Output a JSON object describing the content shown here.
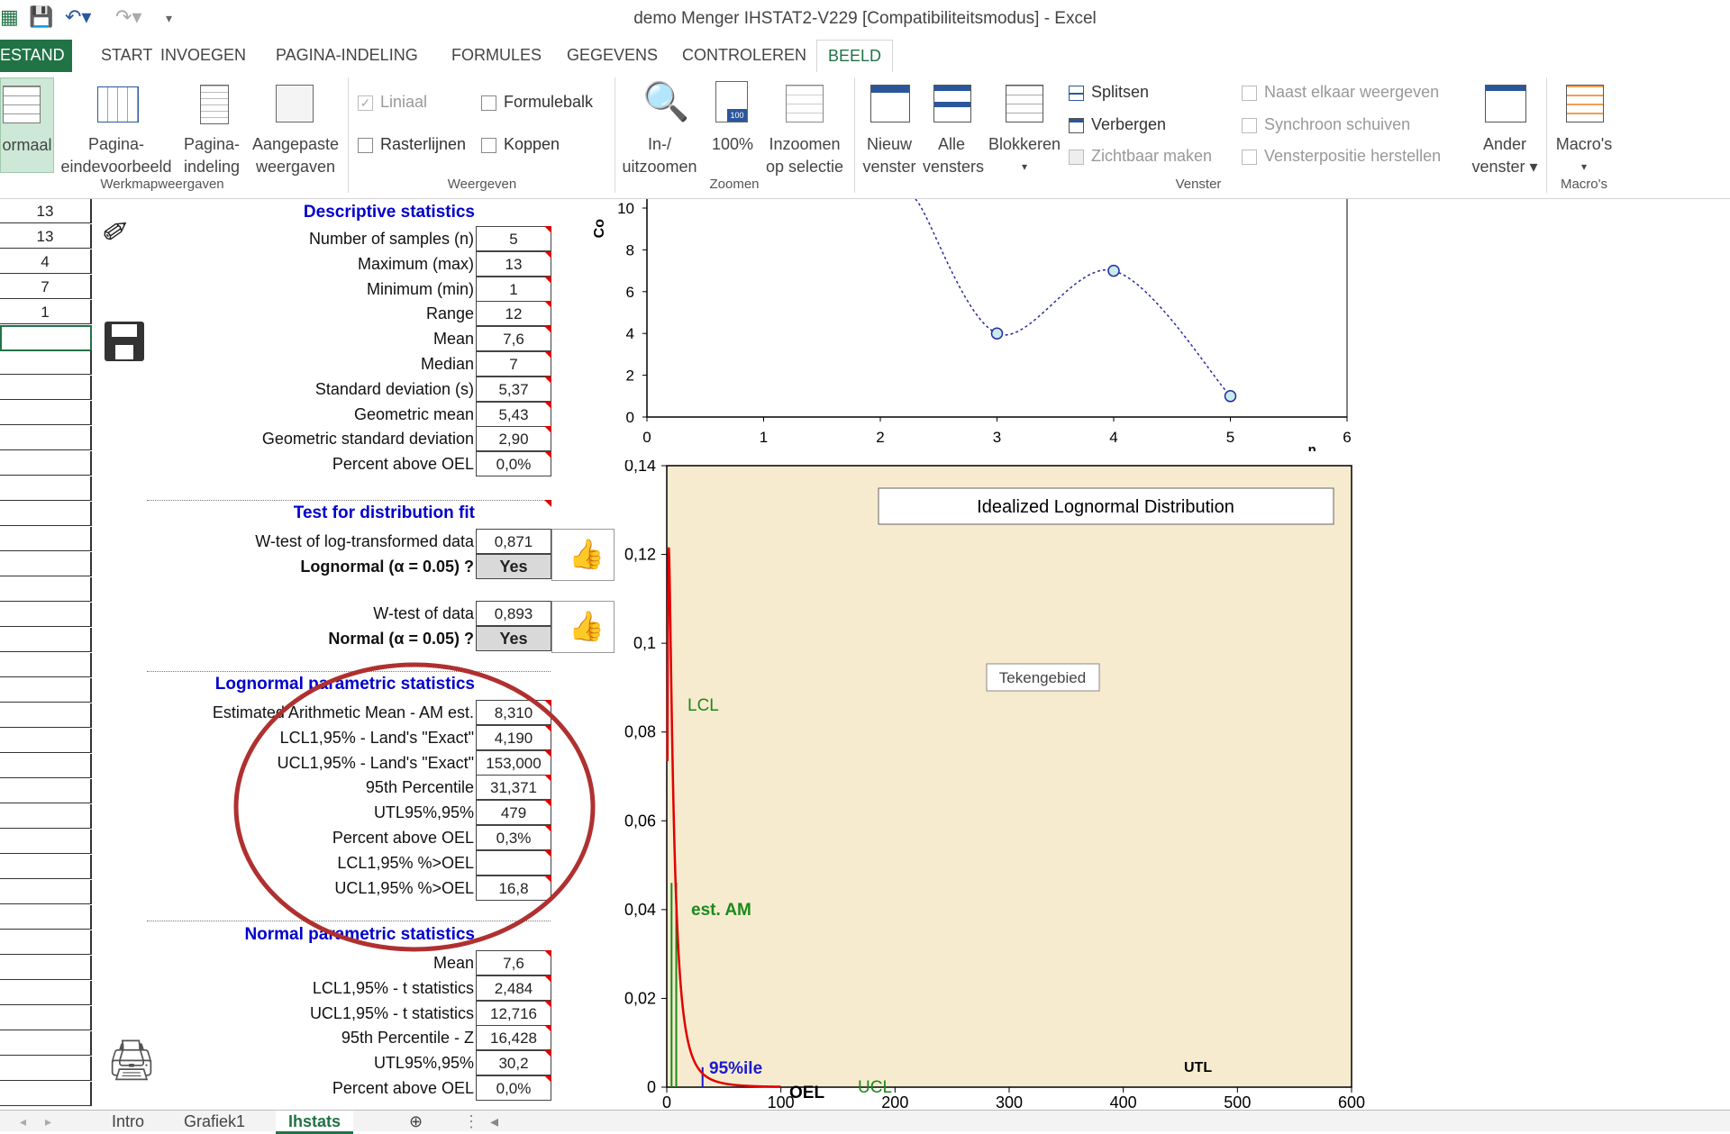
{
  "window": {
    "title": "demo Menger IHSTAT2-V229  [Compatibiliteitsmodus] - Excel"
  },
  "tabs": [
    {
      "label": "ESTAND"
    },
    {
      "label": "START"
    },
    {
      "label": "INVOEGEN"
    },
    {
      "label": "PAGINA-INDELING"
    },
    {
      "label": "FORMULES"
    },
    {
      "label": "GEGEVENS"
    },
    {
      "label": "CONTROLEREN"
    },
    {
      "label": "BEELD"
    }
  ],
  "ribbon": {
    "views": {
      "normaal": "ormaal",
      "pagina1": "Pagina-",
      "pagina1b": "eindevoorbeeld",
      "pagina2": "Pagina-",
      "pagina2b": "indeling",
      "aangepast": "Aangepaste",
      "aangepast_b": "weergaven",
      "group": "Werkmapweergaven"
    },
    "show": {
      "liniaal": "Liniaal",
      "formulebalk": "Formulebalk",
      "rasterlijnen": "Rasterlijnen",
      "koppen": "Koppen",
      "group": "Weergeven"
    },
    "zoom": {
      "inuit": "In-/",
      "inuit_b": "uitzoomen",
      "p100": "100%",
      "sel": "Inzoomen",
      "sel_b": "op selectie",
      "group": "Zoomen"
    },
    "window": {
      "nieuw": "Nieuw",
      "nieuw_b": "venster",
      "alle": "Alle",
      "alle_b": "vensters",
      "blokkeren": "Blokkeren",
      "splitsen": "Splitsen",
      "verbergen": "Verbergen",
      "zichtbaar": "Zichtbaar maken",
      "naast": "Naast elkaar weergeven",
      "synchroon": "Synchroon schuiven",
      "herstellen": "Vensterpositie herstellen",
      "ander": "Ander",
      "ander_b": "venster",
      "group": "Venster"
    },
    "macros": {
      "label": "Macro's",
      "group": "Macro's"
    }
  },
  "colA": [
    "13",
    "13",
    "4",
    "7",
    "1"
  ],
  "descriptive": {
    "title": "Descriptive statistics",
    "rows": [
      {
        "label": "Number of samples (n)",
        "value": "5"
      },
      {
        "label": "Maximum (max)",
        "value": "13"
      },
      {
        "label": "Minimum (min)",
        "value": "1"
      },
      {
        "label": "Range",
        "value": "12"
      },
      {
        "label": "Mean",
        "value": "7,6"
      },
      {
        "label": "Median",
        "value": "7"
      },
      {
        "label": "Standard deviation (s)",
        "value": "5,37"
      },
      {
        "label": "Geometric mean",
        "value": "5,43"
      },
      {
        "label": "Geometric standard deviation",
        "value": "2,90"
      },
      {
        "label": "Percent above OEL",
        "value": "0,0%"
      }
    ]
  },
  "distfit": {
    "title": "Test for distribution fit",
    "w_log_label": "W-test of log-transformed data",
    "w_log_value": "0,871",
    "lognormal_label": "Lognormal (α = 0.05) ?",
    "lognormal_value": "Yes",
    "w_label": "W-test of data",
    "w_value": "0,893",
    "normal_label": "Normal (α = 0.05) ?",
    "normal_value": "Yes"
  },
  "lognormal": {
    "title": "Lognormal parametric statistics",
    "rows": [
      {
        "label": "Estimated Arithmetic Mean - AM est.",
        "value": "8,310"
      },
      {
        "label": "LCL1,95% - Land's \"Exact\"",
        "value": "4,190"
      },
      {
        "label": "UCL1,95% - Land's \"Exact\"",
        "value": "153,000"
      },
      {
        "label": "95th Percentile",
        "value": "31,371"
      },
      {
        "label": "UTL95%,95%",
        "value": "479"
      },
      {
        "label": "Percent above OEL",
        "value": "0,3%"
      },
      {
        "label": "LCL1,95% %>OEL",
        "value": ""
      },
      {
        "label": "UCL1,95% %>OEL",
        "value": "16,8"
      }
    ]
  },
  "normal": {
    "title": "Normal parametric statistics",
    "rows": [
      {
        "label": "Mean",
        "value": "7,6"
      },
      {
        "label": "LCL1,95% - t statistics",
        "value": "2,484"
      },
      {
        "label": "UCL1,95% - t statistics",
        "value": "12,716"
      },
      {
        "label": "95th Percentile - Z",
        "value": "16,428"
      },
      {
        "label": "UTL95%,95%",
        "value": "30,2"
      },
      {
        "label": "Percent above OEL",
        "value": "0,0%"
      }
    ]
  },
  "chart_data": [
    {
      "type": "line",
      "xlabel": "n",
      "x": [
        3,
        4,
        5
      ],
      "y": [
        4,
        7,
        1
      ],
      "xlim": [
        0,
        6
      ],
      "ylim": [
        0,
        10
      ],
      "xticks": [
        "0",
        "1",
        "2",
        "3",
        "4",
        "5",
        "6"
      ],
      "yticks": [
        "0",
        "2",
        "4",
        "6",
        "8",
        "10"
      ],
      "ylabel_partial": "Co"
    },
    {
      "type": "line",
      "title": "Idealized Lognormal Distribution",
      "xlim": [
        0,
        600
      ],
      "ylim": [
        0,
        0.14
      ],
      "xticks": [
        "0",
        "100",
        "200",
        "300",
        "400",
        "500",
        "600"
      ],
      "yticks": [
        "0",
        "0,02",
        "0,04",
        "0,06",
        "0,08",
        "0,1",
        "0,12",
        "0,14"
      ],
      "labels": [
        "LCL",
        "est. AM",
        "95%ile",
        "OEL",
        "UCL",
        "UTL"
      ],
      "tooltip": "Tekengebied",
      "colors": {
        "plot_bg": "#f7ebcf",
        "curve": "#e00000",
        "lcl": "#1a8a1a",
        "pct95": "#1a1acc"
      }
    }
  ],
  "sheet_tabs": [
    {
      "label": "Intro"
    },
    {
      "label": "Grafiek1"
    },
    {
      "label": "Ihstats"
    }
  ]
}
